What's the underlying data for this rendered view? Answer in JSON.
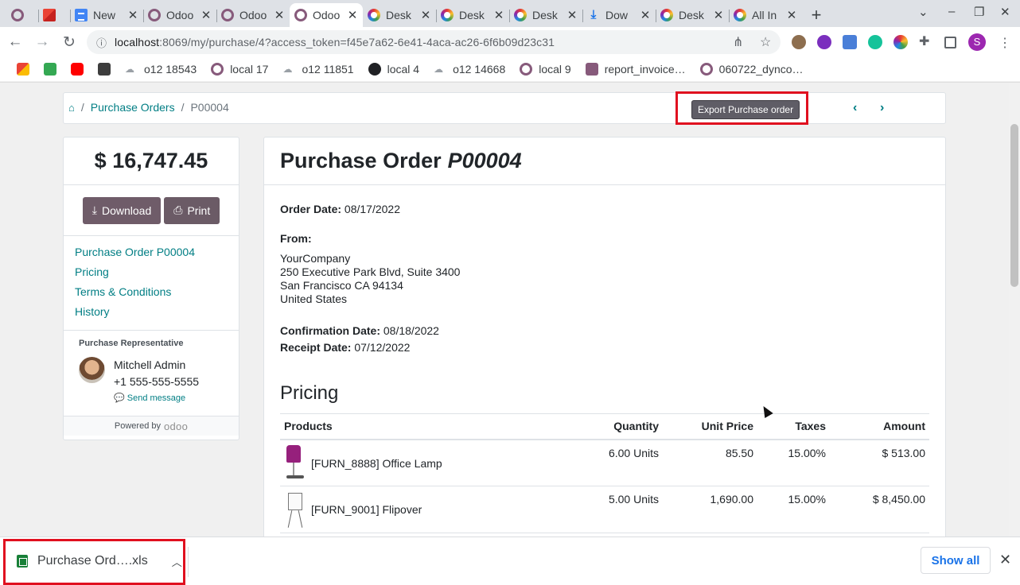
{
  "browser": {
    "tabs": [
      {
        "label": "",
        "icon": "odoo-icon"
      },
      {
        "label": "",
        "icon": "gmail-icon"
      },
      {
        "label": "New",
        "icon": "docs-icon"
      },
      {
        "label": "Odoo",
        "icon": "odoo-icon"
      },
      {
        "label": "Odoo",
        "icon": "odoo-icon"
      },
      {
        "label": "Odoo",
        "icon": "odoo-icon",
        "active": true
      },
      {
        "label": "Desk",
        "icon": "ring-icon"
      },
      {
        "label": "Desk",
        "icon": "ring-icon"
      },
      {
        "label": "Desk",
        "icon": "ring-icon"
      },
      {
        "label": "Dow",
        "icon": "download-icon"
      },
      {
        "label": "Desk",
        "icon": "ring-icon"
      },
      {
        "label": "All In",
        "icon": "ring-icon"
      }
    ],
    "url_host": "localhost",
    "url_rest": ":8069/my/purchase/4?access_token=f45e7a62-6e41-4aca-ac26-6f6b09d23c31",
    "profile_initial": "S",
    "bookmarks": [
      {
        "label": "",
        "icon": "gmail-icon"
      },
      {
        "label": "",
        "icon": "green-ext-icon"
      },
      {
        "label": "",
        "icon": "youtube-icon"
      },
      {
        "label": "",
        "icon": "b-icon"
      },
      {
        "label": "o12 18543",
        "icon": "cloud-icon"
      },
      {
        "label": "local 17",
        "icon": "odoo-icon"
      },
      {
        "label": "o12 11851",
        "icon": "cloud-icon"
      },
      {
        "label": "local 4",
        "icon": "globe-icon"
      },
      {
        "label": "o12 14668",
        "icon": "cloud-icon"
      },
      {
        "label": "local 9",
        "icon": "odoo-icon"
      },
      {
        "label": "report_invoice…",
        "icon": "odoo-square-icon"
      },
      {
        "label": "060722_dynco…",
        "icon": "odoo-icon"
      }
    ]
  },
  "breadcrumb": {
    "home": "",
    "purchase_orders": "Purchase Orders",
    "current": "P00004"
  },
  "export_button": "Export Purchase order",
  "sidebar": {
    "total": "$ 16,747.45",
    "download": "Download",
    "print": "Print",
    "toc": [
      "Purchase Order P00004",
      "Pricing",
      "Terms & Conditions",
      "History"
    ],
    "rep_heading": "Purchase Representative",
    "rep_name": "Mitchell Admin",
    "rep_phone": "+1 555-555-5555",
    "send_message": "Send message",
    "powered_by": "Powered by",
    "odoo_logo": "odoo"
  },
  "order": {
    "title_prefix": "Purchase Order",
    "title_ref": "P00004",
    "order_date_label": "Order Date:",
    "order_date": "08/17/2022",
    "from_label": "From:",
    "company": "YourCompany",
    "address1": "250 Executive Park Blvd, Suite 3400",
    "address2": "San Francisco CA 94134",
    "address3": "United States",
    "confirmation_label": "Confirmation Date:",
    "confirmation_date": "08/18/2022",
    "receipt_label": "Receipt Date:",
    "receipt_date": "07/12/2022",
    "pricing_heading": "Pricing",
    "columns": [
      "Products",
      "Quantity",
      "Unit Price",
      "Taxes",
      "Amount"
    ],
    "lines": [
      {
        "product": "[FURN_8888] Office Lamp",
        "qty": "6.00 Units",
        "price": "85.50",
        "taxes": "15.00%",
        "amount": "$ 513.00",
        "image": "lamp"
      },
      {
        "product": "[FURN_9001] Flipover",
        "qty": "5.00 Units",
        "price": "1,690.00",
        "taxes": "15.00%",
        "amount": "$ 8,450.00",
        "image": "flipover"
      }
    ]
  },
  "downloads": {
    "file": "Purchase Ord….xls",
    "show_all": "Show all"
  }
}
